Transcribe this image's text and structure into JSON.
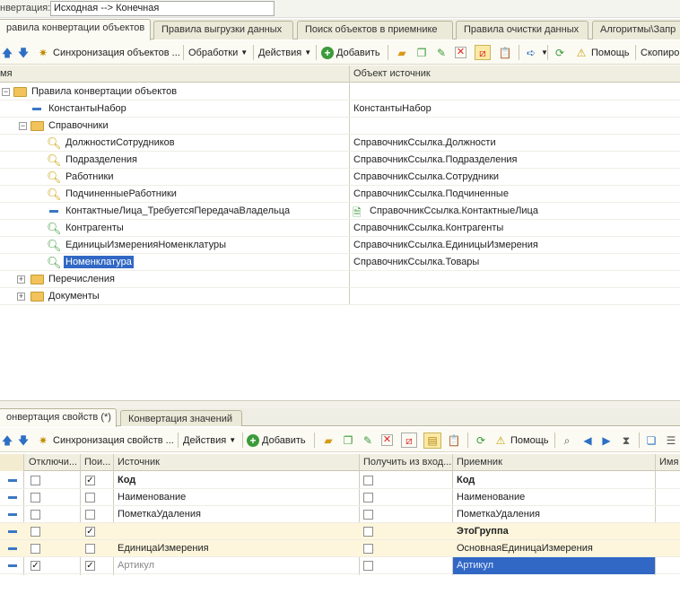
{
  "top": {
    "label": "нвертация:",
    "value": "Исходная --> Конечная"
  },
  "main_tabs": [
    "равила конвертации объектов",
    "Правила выгрузки данных",
    "Поиск объектов в приемнике",
    "Правила очистки данных",
    "Алгоритмы\\Запр"
  ],
  "toolbar1": {
    "sync": "Синхронизация объектов ...",
    "processing": "Обработки",
    "actions": "Действия",
    "add": "Добавить",
    "help": "Помощь",
    "copy": "Скопиро"
  },
  "tree_headers": {
    "name": "мя",
    "source": "Объект источник"
  },
  "tree_rows": [
    {
      "name": "Правила конвертации объектов",
      "source": ""
    },
    {
      "name": "КонстантыНабор",
      "source": "КонстантыНабор"
    },
    {
      "name": "Справочники",
      "source": ""
    },
    {
      "name": "ДолжностиСотрудников",
      "source": "СправочникСсылка.Должности"
    },
    {
      "name": "Подразделения",
      "source": "СправочникСсылка.Подразделения"
    },
    {
      "name": "Работники",
      "source": "СправочникСсылка.Сотрудники"
    },
    {
      "name": "ПодчиненныеРаботники",
      "source": "СправочникСсылка.Подчиненные"
    },
    {
      "name": "КонтактныеЛица_ТребуетсяПередачаВладельца",
      "source": "СправочникСсылка.КонтактныеЛица"
    },
    {
      "name": "Контрагенты",
      "source": "СправочникСсылка.Контрагенты"
    },
    {
      "name": "ЕдиницыИзмеренияНоменклатуры",
      "source": "СправочникСсылка.ЕдиницыИзмерения"
    },
    {
      "name": "Номенклатура",
      "source": "СправочникСсылка.Товары"
    },
    {
      "name": "Перечисления",
      "source": ""
    },
    {
      "name": "Документы",
      "source": ""
    }
  ],
  "bottom_tabs": [
    "онвертация свойств (*)",
    "Конвертация значений"
  ],
  "toolbar2": {
    "sync": "Синхронизация свойств ...",
    "actions": "Действия",
    "add": "Добавить",
    "help": "Помощь"
  },
  "grid_headers": {
    "disabled": "Отключи...",
    "search": "Пои...",
    "source": "Источник",
    "get_from_input": "Получить из вход...",
    "receiver": "Приемник",
    "name": "Имя"
  },
  "grid_rows": [
    {
      "disabled": false,
      "search": true,
      "source": "Код",
      "get": false,
      "receiver": "Код"
    },
    {
      "disabled": false,
      "search": false,
      "source": "Наименование",
      "get": false,
      "receiver": "Наименование"
    },
    {
      "disabled": false,
      "search": false,
      "source": "ПометкаУдаления",
      "get": false,
      "receiver": "ПометкаУдаления"
    },
    {
      "disabled": false,
      "search": true,
      "source": "",
      "get": false,
      "receiver": "ЭтоГруппа"
    },
    {
      "disabled": false,
      "search": false,
      "source": "ЕдиницаИзмерения",
      "get": false,
      "receiver": "ОсновнаяЕдиницаИзмерения"
    },
    {
      "disabled": true,
      "search": true,
      "source": "Артикул",
      "get": false,
      "receiver": "Артикул"
    }
  ]
}
